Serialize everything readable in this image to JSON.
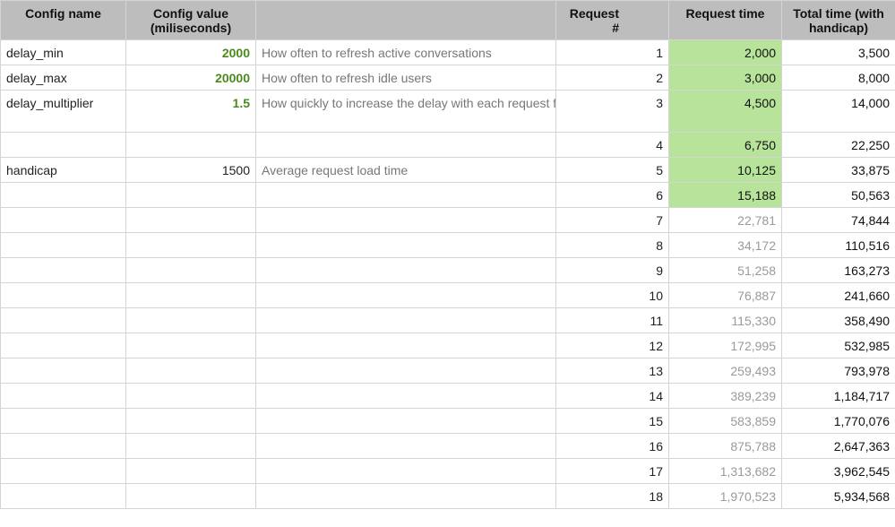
{
  "headers": {
    "config_name": "Config name",
    "config_value": "Config value (miliseconds)",
    "description": "",
    "request_num": "Request #",
    "request_time": "Request time",
    "total_time": "Total time (with handicap)"
  },
  "config_rows": [
    {
      "name": "delay_min",
      "value": "2000",
      "description": "How often to refresh active conversations"
    },
    {
      "name": "delay_max",
      "value": "20000",
      "description": "How often to refresh idle users"
    },
    {
      "name": "delay_multiplier",
      "value": "1.5",
      "description": "How quickly to increase the delay with each request for idle users"
    },
    {
      "name": "",
      "value": "",
      "description": ""
    },
    {
      "name": "handicap",
      "value": "1500",
      "description": "Average request load time"
    }
  ],
  "requests": [
    {
      "num": "1",
      "time": "2,000",
      "total": "3,500"
    },
    {
      "num": "2",
      "time": "3,000",
      "total": "8,000"
    },
    {
      "num": "3",
      "time": "4,500",
      "total": "14,000"
    },
    {
      "num": "4",
      "time": "6,750",
      "total": "22,250"
    },
    {
      "num": "5",
      "time": "10,125",
      "total": "33,875"
    },
    {
      "num": "6",
      "time": "15,188",
      "total": "50,563"
    },
    {
      "num": "7",
      "time": "22,781",
      "total": "74,844"
    },
    {
      "num": "8",
      "time": "34,172",
      "total": "110,516"
    },
    {
      "num": "9",
      "time": "51,258",
      "total": "163,273"
    },
    {
      "num": "10",
      "time": "76,887",
      "total": "241,660"
    },
    {
      "num": "11",
      "time": "115,330",
      "total": "358,490"
    },
    {
      "num": "12",
      "time": "172,995",
      "total": "532,985"
    },
    {
      "num": "13",
      "time": "259,493",
      "total": "793,978"
    },
    {
      "num": "14",
      "time": "389,239",
      "total": "1,184,717"
    },
    {
      "num": "15",
      "time": "583,859",
      "total": "1,770,076"
    },
    {
      "num": "16",
      "time": "875,788",
      "total": "2,647,363"
    },
    {
      "num": "17",
      "time": "1,313,682",
      "total": "3,962,545"
    },
    {
      "num": "18",
      "time": "1,970,523",
      "total": "5,934,568"
    }
  ],
  "colors": {
    "header_bg": "#bdbdbd",
    "highlight_bg": "#b7e49a",
    "config_value_green": "#4a8a1c",
    "muted_text": "#9a9a9a"
  }
}
